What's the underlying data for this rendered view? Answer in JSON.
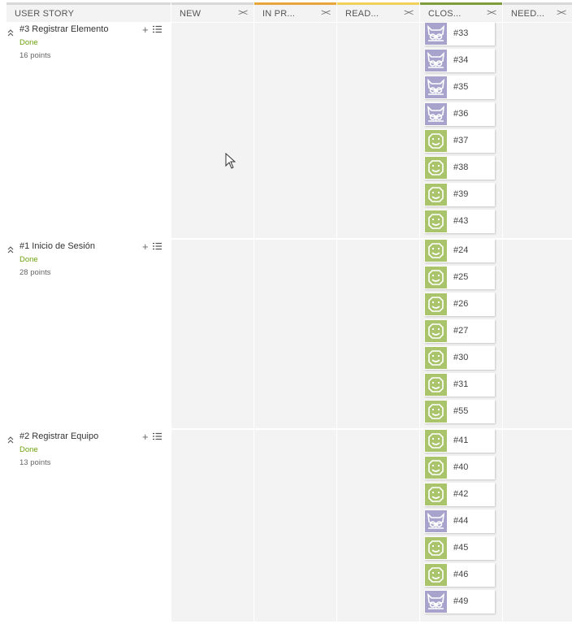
{
  "columns": [
    {
      "label": "USER STORY",
      "fold": ""
    },
    {
      "label": "NEW",
      "fold": "><",
      "color": "#d8d8d8"
    },
    {
      "label": "IN PR...",
      "fold": "><",
      "color": "#e8a53c"
    },
    {
      "label": "READ...",
      "fold": "><",
      "color": "#f2d15a"
    },
    {
      "label": "CLOS...",
      "fold": "><",
      "color": "#7f9d3c"
    },
    {
      "label": "NEED...",
      "fold": "><",
      "color": "#d8d8d8"
    }
  ],
  "stories": [
    {
      "title": "#3 Registrar Elemento",
      "status": "Done",
      "points": "16 points",
      "tasks": [
        {
          "ref": "#33",
          "avatar": "owl"
        },
        {
          "ref": "#34",
          "avatar": "owl"
        },
        {
          "ref": "#35",
          "avatar": "owl"
        },
        {
          "ref": "#36",
          "avatar": "owl"
        },
        {
          "ref": "#37",
          "avatar": "face"
        },
        {
          "ref": "#38",
          "avatar": "face"
        },
        {
          "ref": "#39",
          "avatar": "face"
        },
        {
          "ref": "#43",
          "avatar": "face"
        }
      ]
    },
    {
      "title": "#1 Inicio de Sesión",
      "status": "Done",
      "points": "28 points",
      "tasks": [
        {
          "ref": "#24",
          "avatar": "face"
        },
        {
          "ref": "#25",
          "avatar": "face"
        },
        {
          "ref": "#26",
          "avatar": "face"
        },
        {
          "ref": "#27",
          "avatar": "face"
        },
        {
          "ref": "#30",
          "avatar": "face"
        },
        {
          "ref": "#31",
          "avatar": "face"
        },
        {
          "ref": "#55",
          "avatar": "face"
        }
      ]
    },
    {
      "title": "#2 Registrar Equipo",
      "status": "Done",
      "points": "13 points",
      "tasks": [
        {
          "ref": "#41",
          "avatar": "face"
        },
        {
          "ref": "#40",
          "avatar": "face"
        },
        {
          "ref": "#42",
          "avatar": "face"
        },
        {
          "ref": "#44",
          "avatar": "owl"
        },
        {
          "ref": "#45",
          "avatar": "face"
        },
        {
          "ref": "#46",
          "avatar": "face"
        },
        {
          "ref": "#49",
          "avatar": "owl"
        }
      ]
    }
  ],
  "colors": {
    "done": "#6fa112",
    "avatar_face": "#a9c46a",
    "avatar_owl": "#a7a3cc"
  },
  "icons": {
    "collapse": "chevron-up-icon",
    "add": "plus-icon",
    "bulk": "list-icon",
    "fold": "fold-icon"
  }
}
